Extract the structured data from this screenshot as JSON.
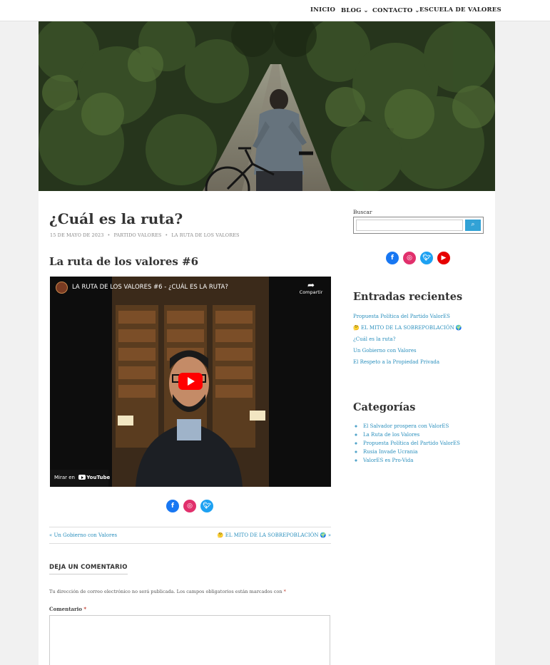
{
  "nav": {
    "items": [
      {
        "label": "INICIO",
        "dropdown": false
      },
      {
        "label": "BLOG",
        "dropdown": true
      },
      {
        "label": "CONTACTO",
        "dropdown": true
      },
      {
        "label": "ESCUELA DE VALORES",
        "dropdown": false
      }
    ]
  },
  "post": {
    "title": "¿Cuál es la ruta?",
    "date": "15 DE MAYO DE 2023",
    "author": "PARTIDO VALORES",
    "category": "LA RUTA DE LOS VALORES",
    "subtitle": "La ruta de los valores #6"
  },
  "video": {
    "title": "LA RUTA DE LOS VALORES #6 - ¿CUÁL ES LA RUTA?",
    "share_label": "Compartir",
    "watch_label": "Mirar en",
    "youtube_label": "YouTube"
  },
  "social_icons": [
    "facebook-icon",
    "instagram-icon",
    "twitter-icon",
    "youtube-icon"
  ],
  "post_nav": {
    "prev": "« Un Gobierno con Valores",
    "next": "EL MITO DE LA SOBREPOBLACIÓN",
    "next_arrow": "»",
    "next_prefix_emoji": "🤔",
    "next_suffix_emoji": "🌍"
  },
  "comments": {
    "heading": "DEJA UN COMENTARIO",
    "notice": "Tu dirección de correo electrónico no será publicada. Los campos obligatorios están marcados con",
    "required_mark": "*",
    "comment_label": "Comentario"
  },
  "sidebar": {
    "search_label": "Buscar",
    "search_placeholder": "",
    "search_button_icon": "search-icon",
    "recent_title": "Entradas recientes",
    "recent": [
      "Propuesta Política del Partido ValorES",
      "🤔 EL MITO DE LA SOBREPOBLACIÓN 🌍",
      "¿Cuál es la ruta?",
      "Un Gobierno con Valores",
      "El Respeto a la Propiedad Privada"
    ],
    "categories_title": "Categorías",
    "categories": [
      "El Salvador prospera con ValorES",
      "La Ruta de los Valores",
      "Propuesta Política del Partido ValorES",
      "Rusia Invade Ucrania",
      "ValorES es Pro-Vida"
    ]
  },
  "colors": {
    "link": "#2a8fbd",
    "facebook": "#1877f2",
    "instagram": "#e1306c",
    "twitter": "#1da1f2",
    "youtube": "#ff0000",
    "search_button": "#32a2d6"
  }
}
